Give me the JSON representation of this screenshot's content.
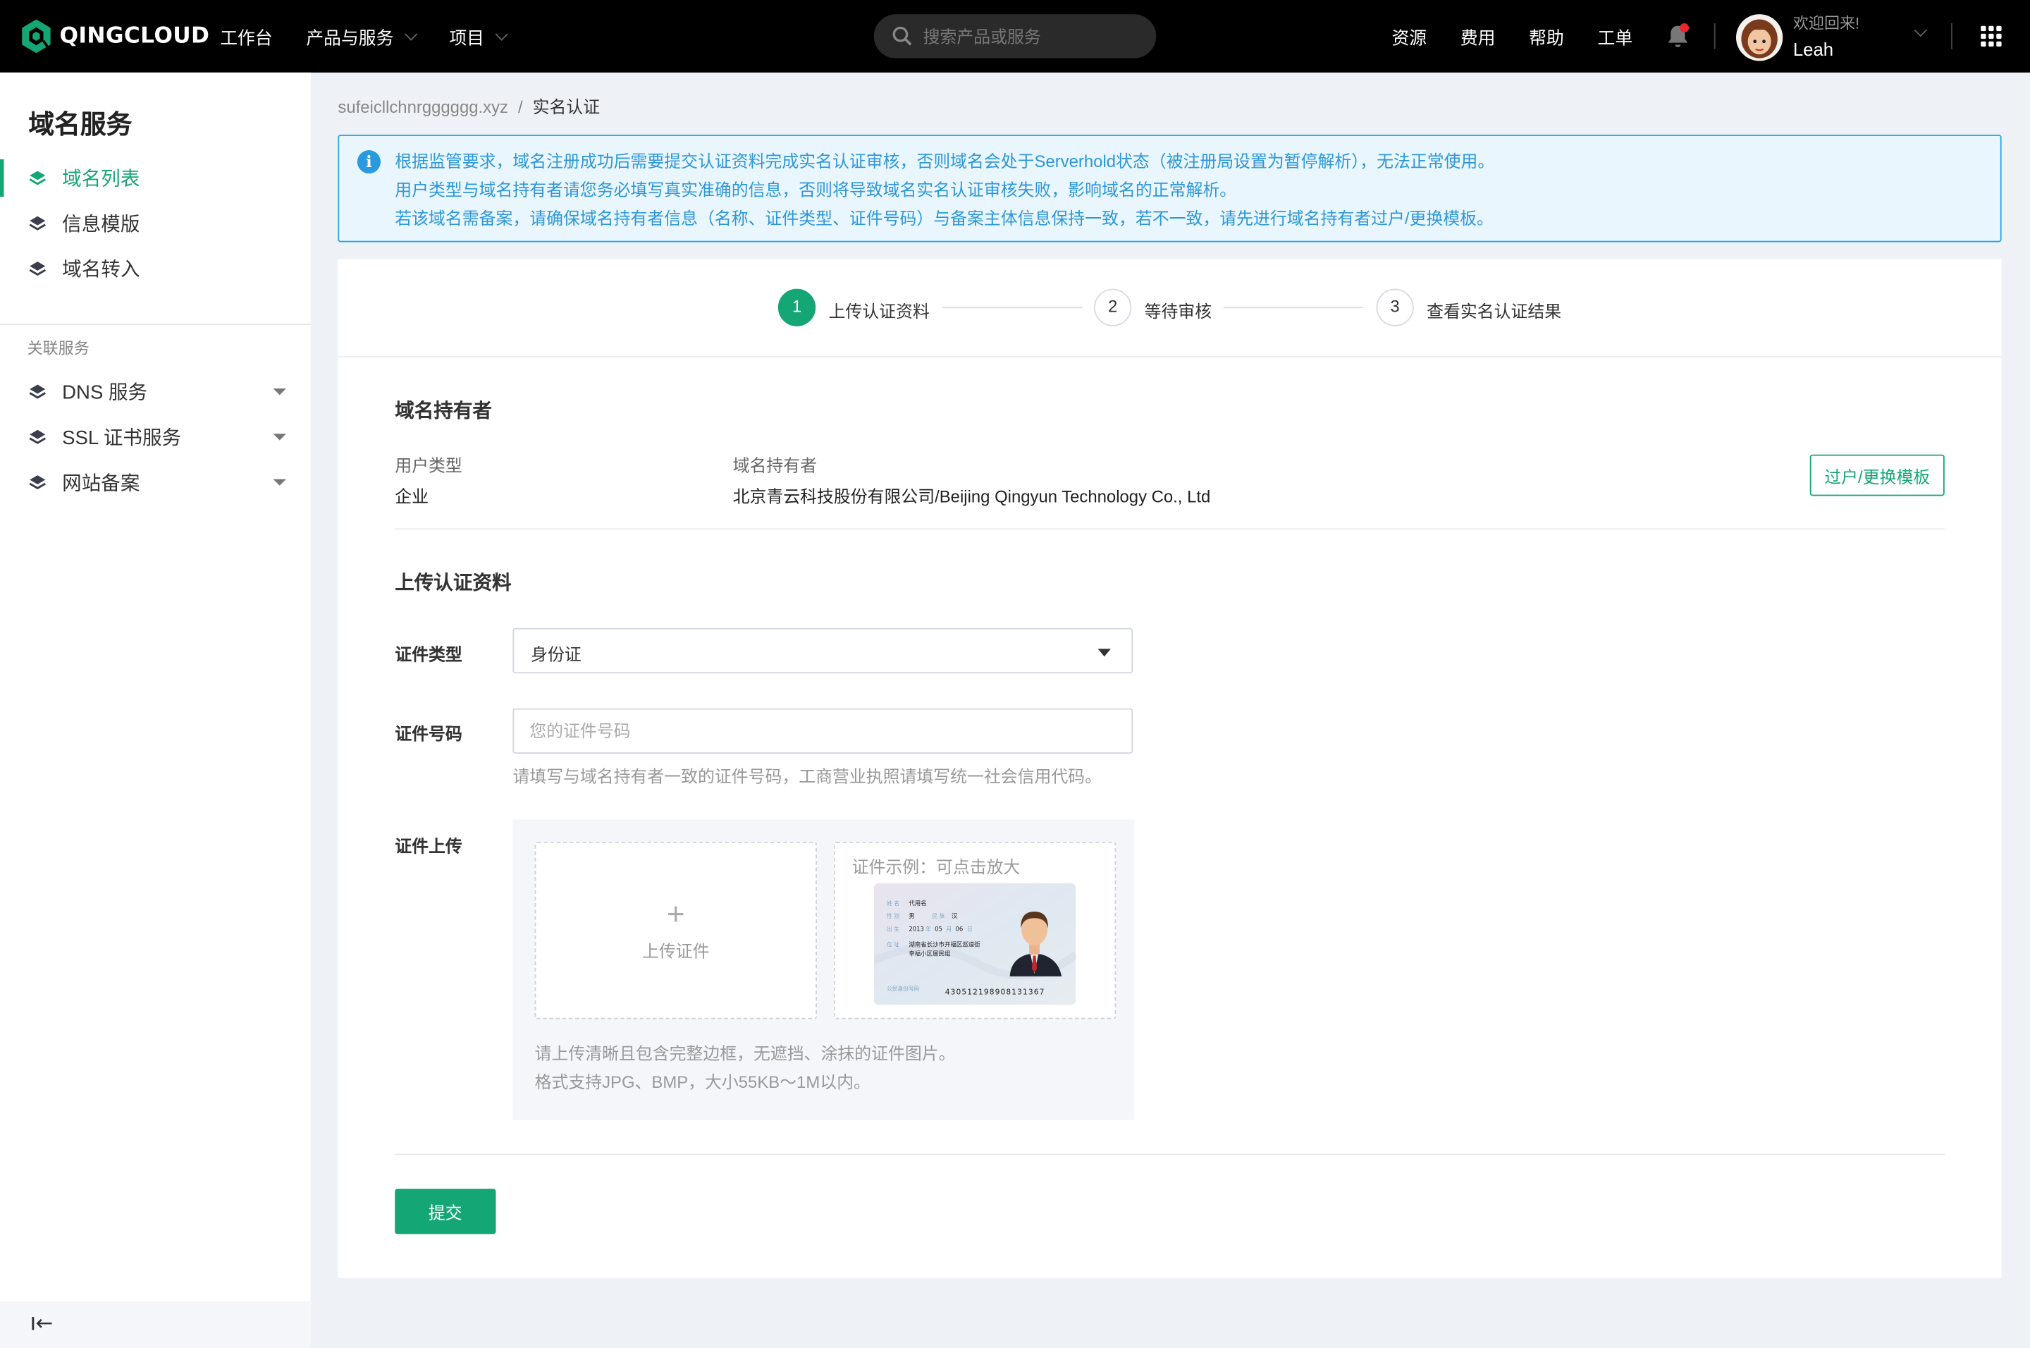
{
  "topbar": {
    "logo_text": "QINGCLOUD",
    "nav": [
      {
        "label": "工作台",
        "has_dropdown": false
      },
      {
        "label": "产品与服务",
        "has_dropdown": true
      },
      {
        "label": "项目",
        "has_dropdown": true
      }
    ],
    "search_placeholder": "搜索产品或服务",
    "links": [
      "资源",
      "费用",
      "帮助",
      "工单"
    ],
    "notification_dot": true,
    "welcome": "欢迎回来!",
    "username": "Leah"
  },
  "sidebar": {
    "title": "域名服务",
    "items": [
      {
        "label": "域名列表",
        "active": true
      },
      {
        "label": "信息模版",
        "active": false
      },
      {
        "label": "域名转入",
        "active": false
      }
    ],
    "section_label": "关联服务",
    "related": [
      {
        "label": "DNS 服务"
      },
      {
        "label": "SSL 证书服务"
      },
      {
        "label": "网站备案"
      }
    ]
  },
  "breadcrumb": {
    "parent": "sufeicllchnrgggggg.xyz",
    "separator": "/",
    "current": "实名认证"
  },
  "notice": {
    "lines": [
      "根据监管要求，域名注册成功后需要提交认证资料完成实名认证审核，否则域名会处于Serverhold状态（被注册局设置为暂停解析），无法正常使用。",
      "用户类型与域名持有者请您务必填写真实准确的信息，否则将导致域名实名认证审核失败，影响域名的正常解析。",
      "若该域名需备案，请确保域名持有者信息（名称、证件类型、证件号码）与备案主体信息保持一致，若不一致，请先进行域名持有者过户/更换模板。"
    ]
  },
  "steps": [
    {
      "number": "1",
      "label": "上传认证资料",
      "active": true
    },
    {
      "number": "2",
      "label": "等待审核",
      "active": false
    },
    {
      "number": "3",
      "label": "查看实名认证结果",
      "active": false
    }
  ],
  "holder": {
    "section_title": "域名持有者",
    "user_type_label": "用户类型",
    "user_type_value": "企业",
    "holder_label": "域名持有者",
    "holder_value": "北京青云科技股份有限公司/Beijing Qingyun Technology Co., Ltd",
    "transfer_button": "过户/更换模板"
  },
  "upload": {
    "section_title": "上传认证资料",
    "cert_type_label": "证件类型",
    "cert_type_value": "身份证",
    "cert_no_label": "证件号码",
    "cert_no_placeholder": "您的证件号码",
    "cert_no_hint": "请填写与域名持有者一致的证件号码，工商营业执照请填写统一社会信用代码。",
    "cert_upload_label": "证件上传",
    "upload_box_label": "上传证件",
    "example_title": "证件示例：可点击放大",
    "example_card": {
      "name_value": "代用名",
      "gender_value": "男",
      "ethnicity_value": "汉",
      "birth_year": "2013",
      "birth_month": "05",
      "birth_day": "06",
      "address_line1": "湖南省长沙市开福区巡道街",
      "address_line2": "幸福小区居民组",
      "id_number": "430512198908131367"
    },
    "notes": [
      "请上传清晰且包含完整边框，无遮挡、涂抹的证件图片。",
      "格式支持JPG、BMP，大小55KB～1M以内。"
    ],
    "submit_label": "提交"
  },
  "colors": {
    "accent": "#15a675",
    "topbar_bg": "#000000",
    "notice_border": "#2aa4e4",
    "notice_text": "#2d97d8",
    "page_bg": "#eef1f6"
  }
}
